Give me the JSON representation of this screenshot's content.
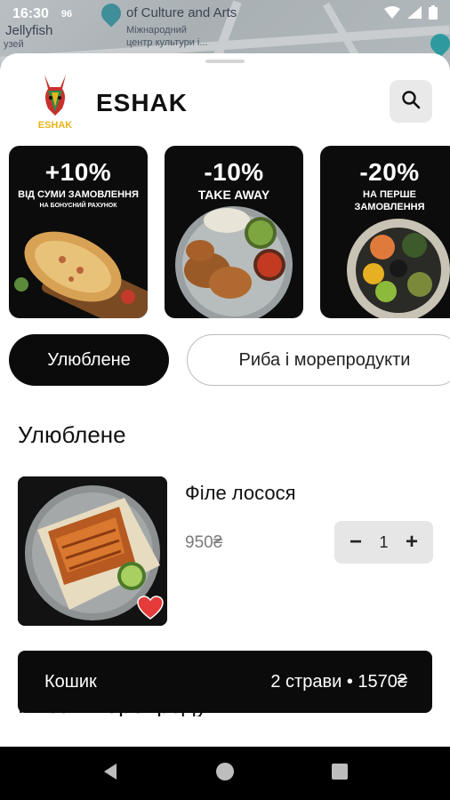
{
  "status_bar": {
    "time": "16:30",
    "badge": "96"
  },
  "map": {
    "label_culture": "of Culture and Arts",
    "label_jellyfish": "Jellyfish",
    "label_center": "Міжнародний",
    "label_center2": "центр культури і...",
    "label_muzej": "узей"
  },
  "header": {
    "brand": "ESHAK",
    "logo_text": "ESHAK"
  },
  "banners": [
    {
      "headline": "+10%",
      "line1": "ВІД СУМИ ЗАМОВЛЕННЯ",
      "line2": "НА БОНУСНИЙ РАХУНОК"
    },
    {
      "headline": "-10%",
      "line1": "TAKE AWAY",
      "line2": ""
    },
    {
      "headline": "-20%",
      "line1": "НА ПЕРШЕ",
      "line2": "ЗАМОВЛЕННЯ"
    }
  ],
  "categories": {
    "active": "Улюблене",
    "next": "Риба і морепродукти"
  },
  "section": {
    "title": "Улюблене"
  },
  "product": {
    "name": "Філе лосося",
    "price": "950₴",
    "quantity": "1",
    "favorite": true
  },
  "next_section_peek": "Риба і морепродукти",
  "cart": {
    "label": "Кошик",
    "summary": "2 страви • 1570₴"
  },
  "colors": {
    "accent": "#0b0b0b",
    "heart": "#e63b3b",
    "logo_yellow": "#e7b51a"
  }
}
